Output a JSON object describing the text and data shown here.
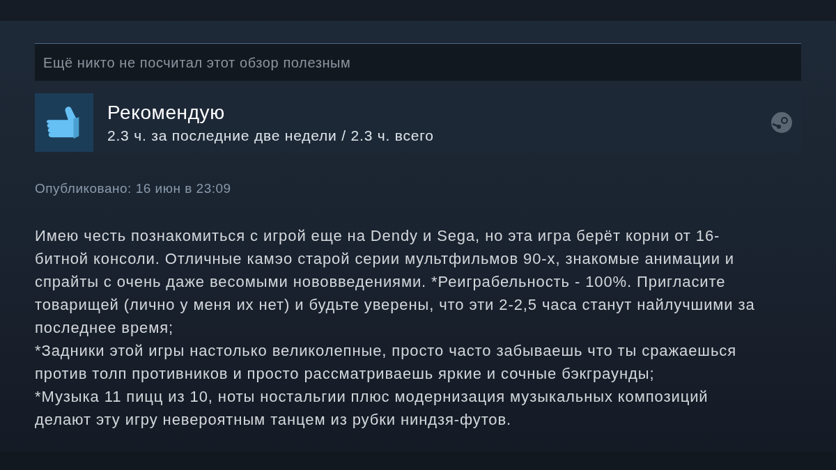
{
  "helpful_bar": {
    "text": "Ещё никто не посчитал этот обзор полезным"
  },
  "review_header": {
    "verdict": "Рекомендую",
    "hours": "2.3 ч. за последние две недели / 2.3 ч. всего"
  },
  "posted": "Опубликовано: 16 июн в 23:09",
  "body": [
    {
      "lines": [
        "Имею честь познакомиться с игрой еще на Dendy и Sega, но эта игра берёт корни от 16-",
        "битной консоли. Отличные камэо старой серии мультфильмов 90-х, знакомые анимации и",
        "спрайты с очень даже весомыми нововведениями. *Реиграбельность - 100%. Пригласите",
        "товарищей (лично у меня их нет) и будьте уверены, что эти 2-2,5 часа станут найлучшими за",
        "последнее время;"
      ]
    },
    {
      "lines": [
        "*Задники этой игры настолько великолепные, просто часто забываешь что ты сражаешься",
        "против толп противников и просто рассматриваешь яркие и сочные бэкграунды;"
      ]
    },
    {
      "lines": [
        "*Музыка 11 пицц из 10, ноты ностальгии плюс модернизация музыкальных композиций",
        "делают эту игру невероятным танцем из рубки ниндзя-футов."
      ]
    }
  ]
}
